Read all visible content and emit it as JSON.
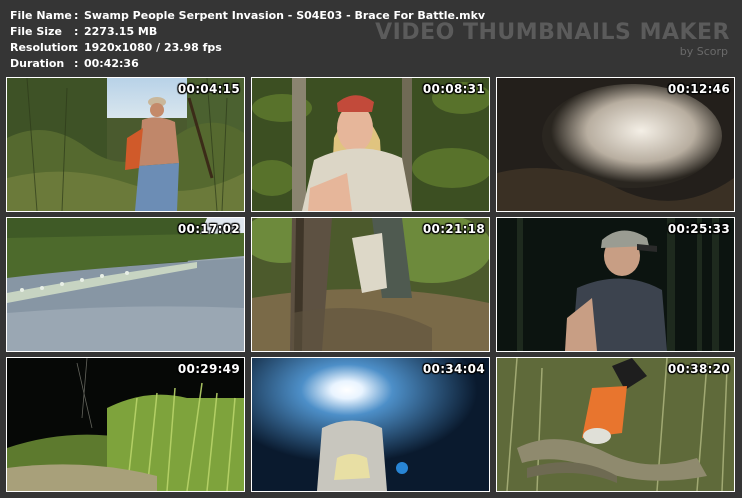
{
  "info": {
    "rows": [
      {
        "label": "File Name",
        "sep": ":",
        "value": "Swamp People Serpent Invasion - S04E03 - Brace For Battle.mkv"
      },
      {
        "label": "File Size",
        "sep": ":",
        "value": "2273.15 MB"
      },
      {
        "label": "Resolution",
        "sep": ":",
        "value": "1920x1080 / 23.98 fps"
      },
      {
        "label": "Duration",
        "sep": ":",
        "value": "00:42:36"
      }
    ]
  },
  "brand": {
    "title": "VIDEO THUMBNAILS MAKER",
    "subtitle": "by Scorp"
  },
  "thumbnails": [
    {
      "timestamp": "00:04:15",
      "scene": "man-in-swamp-brush"
    },
    {
      "timestamp": "00:08:31",
      "scene": "woman-with-bandana-in-jungle"
    },
    {
      "timestamp": "00:12:46",
      "scene": "blurred-closeup-dark"
    },
    {
      "timestamp": "00:17:02",
      "scene": "canal-with-water-plants"
    },
    {
      "timestamp": "00:21:18",
      "scene": "person-crouching-by-tree"
    },
    {
      "timestamp": "00:25:33",
      "scene": "woman-with-headlamp-at-night"
    },
    {
      "timestamp": "00:29:49",
      "scene": "grass-at-night-flash"
    },
    {
      "timestamp": "00:34:04",
      "scene": "headlamp-glare-blue"
    },
    {
      "timestamp": "00:38:20",
      "scene": "python-in-grass-gloved-hand"
    }
  ],
  "colors": {
    "background": "#353535",
    "text": "#ffffff",
    "brand": "#5b5b5b",
    "border": "#ffffff"
  }
}
